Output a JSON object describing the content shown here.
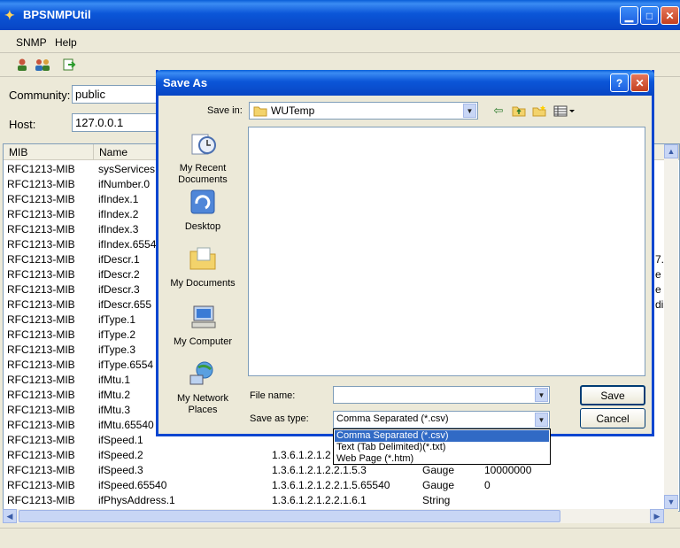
{
  "window": {
    "title": "BPSNMPUtil",
    "menu": [
      "SNMP",
      "Help"
    ],
    "toolbar_icons": [
      "users-icon",
      "group-icon",
      "export-icon"
    ],
    "community_label": "Community:",
    "community_value": "public",
    "host_label": "Host:",
    "host_value": "127.0.0.1"
  },
  "table": {
    "columns": [
      "MIB",
      "Name"
    ],
    "rows": [
      [
        "RFC1213-MIB",
        "sysServices",
        "",
        "",
        ""
      ],
      [
        "RFC1213-MIB",
        "ifNumber.0",
        "",
        "",
        ""
      ],
      [
        "RFC1213-MIB",
        "ifIndex.1",
        "",
        "",
        ""
      ],
      [
        "RFC1213-MIB",
        "ifIndex.2",
        "",
        "",
        ""
      ],
      [
        "RFC1213-MIB",
        "ifIndex.3",
        "",
        "",
        ""
      ],
      [
        "RFC1213-MIB",
        "ifIndex.6554",
        "",
        "",
        ""
      ],
      [
        "RFC1213-MIB",
        "ifDescr.1",
        "",
        "",
        ""
      ],
      [
        "RFC1213-MIB",
        "ifDescr.2",
        "",
        "",
        ""
      ],
      [
        "RFC1213-MIB",
        "ifDescr.3",
        "",
        "",
        ""
      ],
      [
        "RFC1213-MIB",
        "ifDescr.655",
        "",
        "",
        ""
      ],
      [
        "RFC1213-MIB",
        "ifType.1",
        "",
        "",
        ""
      ],
      [
        "RFC1213-MIB",
        "ifType.2",
        "",
        "",
        ""
      ],
      [
        "RFC1213-MIB",
        "ifType.3",
        "",
        "",
        ""
      ],
      [
        "RFC1213-MIB",
        "ifType.6554",
        "",
        "",
        ""
      ],
      [
        "RFC1213-MIB",
        "ifMtu.1",
        "",
        "",
        ""
      ],
      [
        "RFC1213-MIB",
        "ifMtu.2",
        "",
        "",
        ""
      ],
      [
        "RFC1213-MIB",
        "ifMtu.3",
        "",
        "",
        ""
      ],
      [
        "RFC1213-MIB",
        "ifMtu.65540",
        "",
        "",
        ""
      ],
      [
        "RFC1213-MIB",
        "ifSpeed.1",
        "",
        "",
        ""
      ],
      [
        "RFC1213-MIB",
        "ifSpeed.2",
        "1.3.6.1.2.1.2",
        "",
        ""
      ],
      [
        "RFC1213-MIB",
        "ifSpeed.3",
        "1.3.6.1.2.1.2.2.1.5.3",
        "Gauge",
        "10000000"
      ],
      [
        "RFC1213-MIB",
        "ifSpeed.65540",
        "1.3.6.1.2.1.2.2.1.5.65540",
        "Gauge",
        "0"
      ],
      [
        "RFC1213-MIB",
        "ifPhysAddress.1",
        "1.3.6.1.2.1.2.2.1.6.1",
        "String",
        ""
      ]
    ],
    "right_edge_fragments": [
      "",
      "",
      "",
      "",
      "",
      "",
      "7.",
      "e",
      "e",
      "di",
      "",
      "",
      "",
      "",
      "",
      "",
      "",
      "",
      "",
      "",
      "",
      "",
      ""
    ]
  },
  "dialog": {
    "title": "Save As",
    "save_in_label": "Save in:",
    "save_in_value": "WUTemp",
    "places": [
      "My Recent Documents",
      "Desktop",
      "My Documents",
      "My Computer",
      "My Network Places"
    ],
    "file_name_label": "File name:",
    "file_name_value": "",
    "save_as_type_label": "Save as type:",
    "save_as_type_value": "Comma Separated (*.csv)",
    "type_options": [
      "Comma Separated (*.csv)",
      "Text (Tab Delimited)(*.txt)",
      "Web Page (*.htm)"
    ],
    "save_button": "Save",
    "cancel_button": "Cancel",
    "help_glyph": "?",
    "close_glyph": "✕"
  },
  "colors": {
    "title_blue": "#0b56d8",
    "selection": "#316ac5"
  }
}
